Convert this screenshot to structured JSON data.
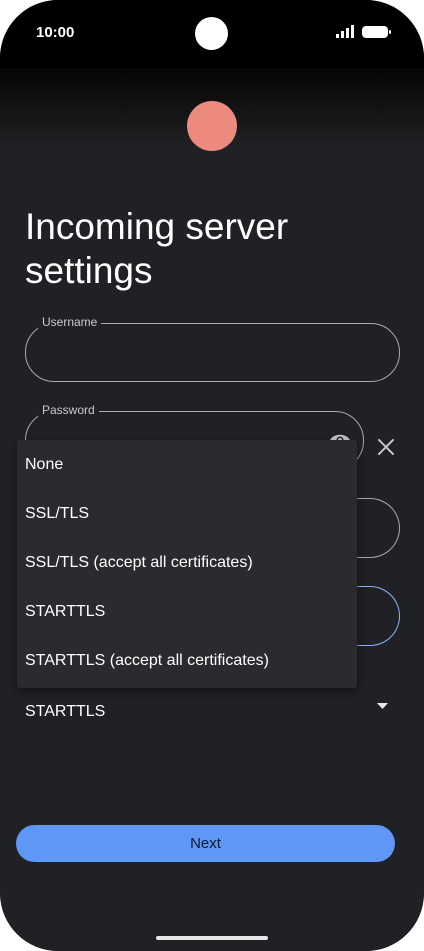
{
  "status_bar": {
    "time": "10:00",
    "icons": [
      "signal-icon",
      "battery-icon"
    ]
  },
  "header": {
    "title": "Incoming server settings"
  },
  "form": {
    "username": {
      "label": "Username",
      "value": ""
    },
    "password": {
      "label": "Password",
      "value": "",
      "icon": "visibility-eye-icon",
      "clear_icon": "close-icon"
    },
    "security": {
      "selected": "STARTTLS",
      "icon": "chevron-down-icon"
    }
  },
  "dropdown": {
    "options": [
      "None",
      "SSL/TLS",
      "SSL/TLS (accept all certificates)",
      "STARTTLS",
      "STARTTLS (accept all certificates)"
    ]
  },
  "footer": {
    "next_label": "Next"
  },
  "colors": {
    "background": "#202124",
    "accent": "#5e97f6",
    "avatar": "#ec8a7e",
    "outline": "#a9aaac",
    "focus_outline": "#8ab4f8"
  }
}
